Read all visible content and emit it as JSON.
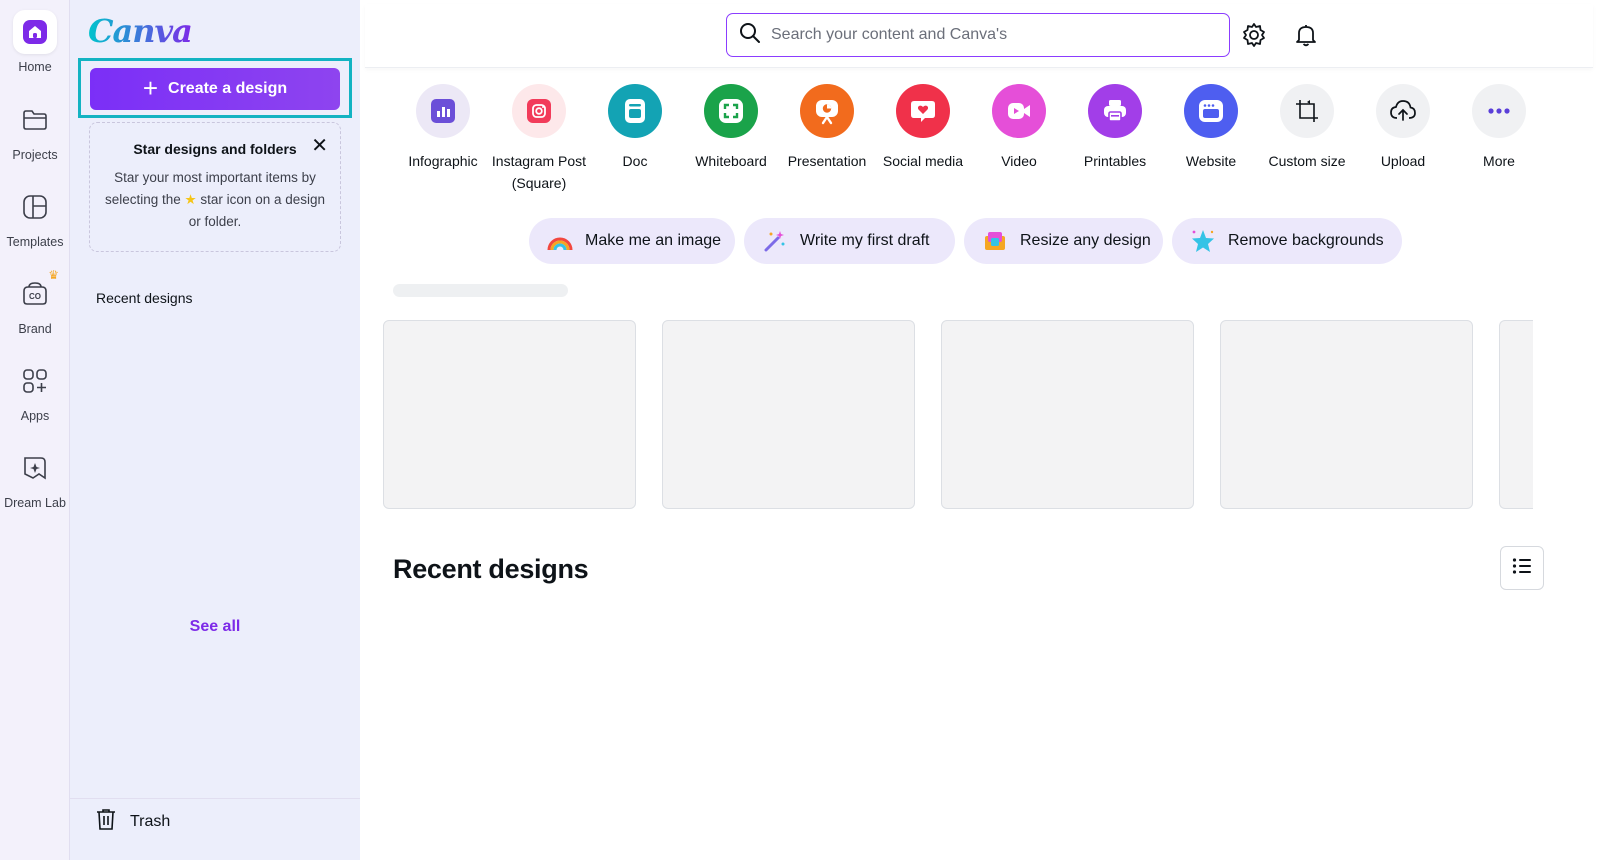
{
  "app": {
    "logo_text": "Canva"
  },
  "rail": {
    "items": [
      {
        "label": "Home",
        "icon": "home-icon",
        "active": true
      },
      {
        "label": "Projects",
        "icon": "folder-icon"
      },
      {
        "label": "Templates",
        "icon": "templates-icon"
      },
      {
        "label": "Brand",
        "icon": "brand-icon",
        "badge": "crown-icon"
      },
      {
        "label": "Apps",
        "icon": "apps-icon"
      },
      {
        "label": "Dream Lab",
        "icon": "dream-lab-icon"
      }
    ]
  },
  "panel": {
    "create_label": "Create a design",
    "star_card": {
      "title": "Star designs and folders",
      "body_before": "Star your most important items by selecting the",
      "body_after": "star icon on a design or folder."
    },
    "recent_label": "Recent designs",
    "see_all": "See all",
    "trash_label": "Trash"
  },
  "topbar": {
    "search_placeholder": "Search your content and Canva's"
  },
  "design_types": [
    {
      "label": "Infographic",
      "color": "#ece8f6",
      "icon": "infographic-icon"
    },
    {
      "label": "Instagram Post (Square)",
      "color": "#fde8ea",
      "icon": "instagram-icon"
    },
    {
      "label": "Doc",
      "color": "#13a3b4",
      "icon": "doc-icon"
    },
    {
      "label": "Whiteboard",
      "color": "#1aa34a",
      "icon": "whiteboard-icon"
    },
    {
      "label": "Presentation",
      "color": "#f26b1d",
      "icon": "presentation-icon"
    },
    {
      "label": "Social media",
      "color": "#f0314a",
      "icon": "social-media-icon"
    },
    {
      "label": "Video",
      "color": "#e54fd8",
      "icon": "video-icon"
    },
    {
      "label": "Printables",
      "color": "#a23ee8",
      "icon": "printables-icon"
    },
    {
      "label": "Website",
      "color": "#4e5ef0",
      "icon": "website-icon"
    },
    {
      "label": "Custom size",
      "color": "#f0f1f3",
      "icon": "custom-size-icon"
    },
    {
      "label": "Upload",
      "color": "#f0f1f3",
      "icon": "upload-icon"
    },
    {
      "label": "More",
      "color": "#f0f1f3",
      "icon": "more-icon"
    }
  ],
  "ai_pills": [
    {
      "label": "Make me an image",
      "icon": "rainbow-icon"
    },
    {
      "label": "Write my first draft",
      "icon": "magic-wand-icon"
    },
    {
      "label": "Resize any design",
      "icon": "resize-icon"
    },
    {
      "label": "Remove backgrounds",
      "icon": "star-sparkle-icon"
    }
  ],
  "main": {
    "recent_title": "Recent designs"
  },
  "colors": {
    "accent": "#7d2ae8",
    "highlight": "#13b3c2"
  }
}
